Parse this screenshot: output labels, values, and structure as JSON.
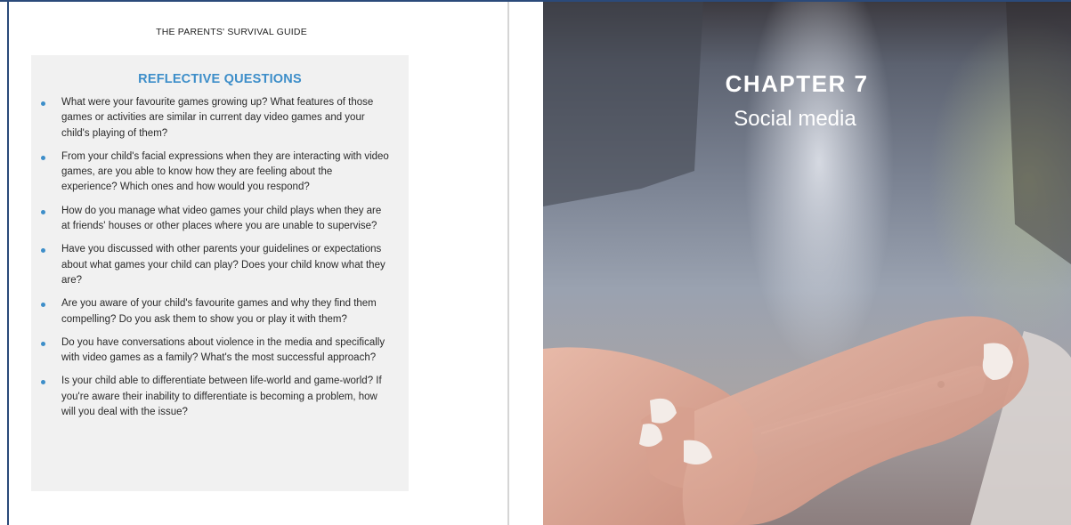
{
  "left_page": {
    "running_head": "THE PARENTS' SURVIVAL GUIDE",
    "box_title": "REFLECTIVE QUESTIONS",
    "questions": [
      "What were your favourite games growing up? What features of those games or activities are similar in current day video games and your child's playing of them?",
      "From your child's facial expressions when they are interacting with video games, are you able to know how they are feeling about the experience? Which ones and how would you respond?",
      "How do you manage what video games your child plays when they are at friends' houses or other places where you are unable to supervise?",
      "Have you discussed with other parents your guidelines or expectations about what games your child can play? Does your child know what they are?",
      "Are you aware of your child's favourite games and why they find them compelling? Do you ask them to show you or play it with them?",
      "Do you have conversations about violence in the media and specifically with video games as a family? What's the most successful approach?",
      "Is your child able to differentiate between life-world and game-world? If you're aware their inability to differentiate is becoming a problem, how will you deal with the issue?"
    ]
  },
  "right_page": {
    "chapter_label": "CHAPTER 7",
    "chapter_title": "Social media"
  },
  "colors": {
    "accent": "#3d8ec9",
    "box_background": "#f1f1f1",
    "frame": "#2b4a7a"
  },
  "icons": {
    "bullet": "bullet-dot"
  }
}
